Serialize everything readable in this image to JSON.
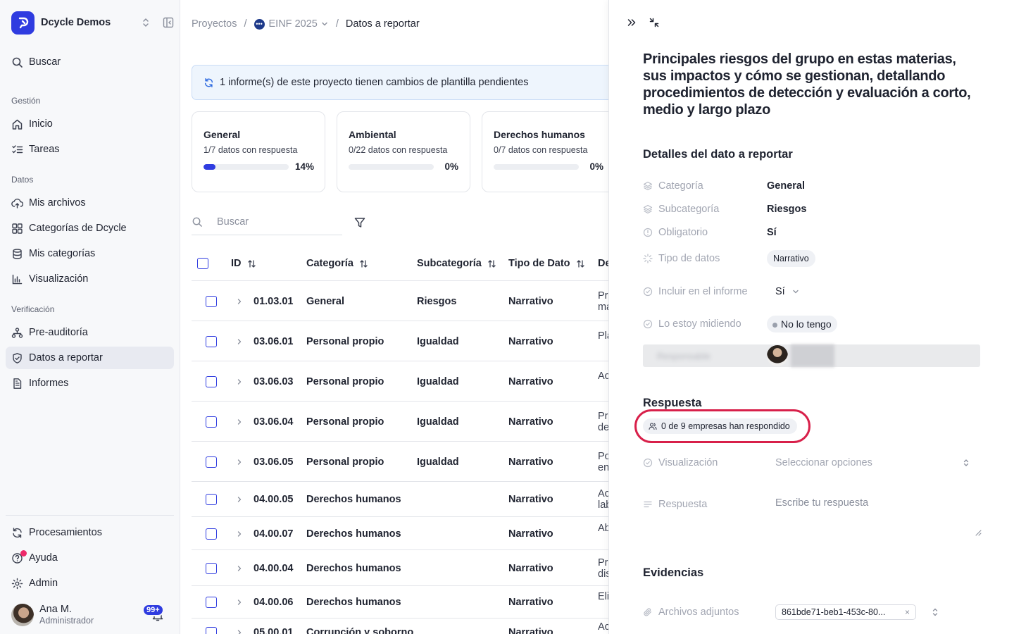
{
  "workspace": {
    "name": "Dcycle Demos"
  },
  "sidebar": {
    "search_label": "Buscar",
    "sections": {
      "gestion": "Gestión",
      "datos": "Datos",
      "verificacion": "Verificación"
    },
    "items": {
      "inicio": "Inicio",
      "tareas": "Tareas",
      "mis_archivos": "Mis archivos",
      "categorias_dcycle": "Categorías de Dcycle",
      "mis_categorias": "Mis categorías",
      "visualizacion": "Visualización",
      "preauditoria": "Pre-auditoría",
      "datos_reportar": "Datos a reportar",
      "informes": "Informes",
      "procesamientos": "Procesamientos",
      "ayuda": "Ayuda",
      "admin": "Admin"
    },
    "active": "datos_reportar"
  },
  "user": {
    "name": "Ana M.",
    "role": "Administrador",
    "notifications": "99+"
  },
  "breadcrumb": {
    "root": "Proyectos",
    "project": "EINF 2025",
    "current": "Datos a reportar"
  },
  "banner": {
    "text": "1 informe(s) de este proyecto tienen cambios de plantilla pendientes"
  },
  "cards": [
    {
      "title": "General",
      "subtitle": "1/7 datos con respuesta",
      "percent_label": "14%",
      "progress": 0.14
    },
    {
      "title": "Ambiental",
      "subtitle": "0/22 datos con respuesta",
      "percent_label": "0%",
      "progress": 0
    },
    {
      "title": "Derechos humanos",
      "subtitle": "0/7 datos con respuesta",
      "percent_label": "0%",
      "progress": 0
    }
  ],
  "search": {
    "placeholder": "Buscar"
  },
  "table": {
    "headers": {
      "id": "ID",
      "categoria": "Categoría",
      "subcategoria": "Subcategoría",
      "tipo": "Tipo de Dato",
      "desc": "De"
    },
    "rows": [
      {
        "id": "01.03.01",
        "categoria": "General",
        "subcategoria": "Riesgos",
        "tipo": "Narrativo",
        "desc1": "Pri",
        "desc2": "ma"
      },
      {
        "id": "03.06.01",
        "categoria": "Personal propio",
        "subcategoria": "Igualdad",
        "tipo": "Narrativo",
        "desc1": "Pla",
        "desc2": ""
      },
      {
        "id": "03.06.03",
        "categoria": "Personal propio",
        "subcategoria": "Igualdad",
        "tipo": "Narrativo",
        "desc1": "Ac",
        "desc2": ""
      },
      {
        "id": "03.06.04",
        "categoria": "Personal propio",
        "subcategoria": "Igualdad",
        "tipo": "Narrativo",
        "desc1": "Pro",
        "desc2": "de"
      },
      {
        "id": "03.06.05",
        "categoria": "Personal propio",
        "subcategoria": "Igualdad",
        "tipo": "Narrativo",
        "desc1": "Po",
        "desc2": "en"
      },
      {
        "id": "04.00.05",
        "categoria": "Derechos humanos",
        "subcategoria": "",
        "tipo": "Narrativo",
        "desc1": "Ac",
        "desc2": "lab"
      },
      {
        "id": "04.00.07",
        "categoria": "Derechos humanos",
        "subcategoria": "",
        "tipo": "Narrativo",
        "desc1": "Ab",
        "desc2": ""
      },
      {
        "id": "04.00.04",
        "categoria": "Derechos humanos",
        "subcategoria": "",
        "tipo": "Narrativo",
        "desc1": "Pro",
        "desc2": "dis"
      },
      {
        "id": "04.00.06",
        "categoria": "Derechos humanos",
        "subcategoria": "",
        "tipo": "Narrativo",
        "desc1": "Eli",
        "desc2": ""
      },
      {
        "id": "05.00.01",
        "categoria": "Corrupción y soborno",
        "subcategoria": "",
        "tipo": "Narrativo",
        "desc1": "Ac",
        "desc2": ""
      }
    ]
  },
  "panel": {
    "title": "Principales riesgos del grupo en estas materias, sus impactos y cómo se gestionan, detallando procedimientos de detección y evaluación a corto, medio y largo plazo",
    "details_heading": "Detalles del dato a reportar",
    "props": {
      "categoria_label": "Categoría",
      "categoria_value": "General",
      "subcategoria_label": "Subcategoría",
      "subcategoria_value": "Riesgos",
      "obligatorio_label": "Obligatorio",
      "obligatorio_value": "Sí",
      "tipo_label": "Tipo de datos",
      "tipo_value": "Narrativo",
      "incluir_label": "Incluir en el informe",
      "incluir_value": "Sí",
      "midiendo_label": "Lo estoy midiendo",
      "midiendo_value": "No lo tengo",
      "responsable_label": "Responsable"
    },
    "respuesta_heading": "Respuesta",
    "responded": "0 de 9 empresas han respondido",
    "visualizacion_label": "Visualización",
    "visualizacion_placeholder": "Seleccionar opciones",
    "respuesta_label": "Respuesta",
    "respuesta_placeholder": "Escribe tu respuesta",
    "evidencias_heading": "Evidencias",
    "adjuntos_label": "Archivos adjuntos",
    "file_name": "861bde71-beb1-453c-80..."
  },
  "colors": {
    "accent": "#2f3ce0",
    "highlight": "#d8204a",
    "notification": "#ee2a6a"
  }
}
